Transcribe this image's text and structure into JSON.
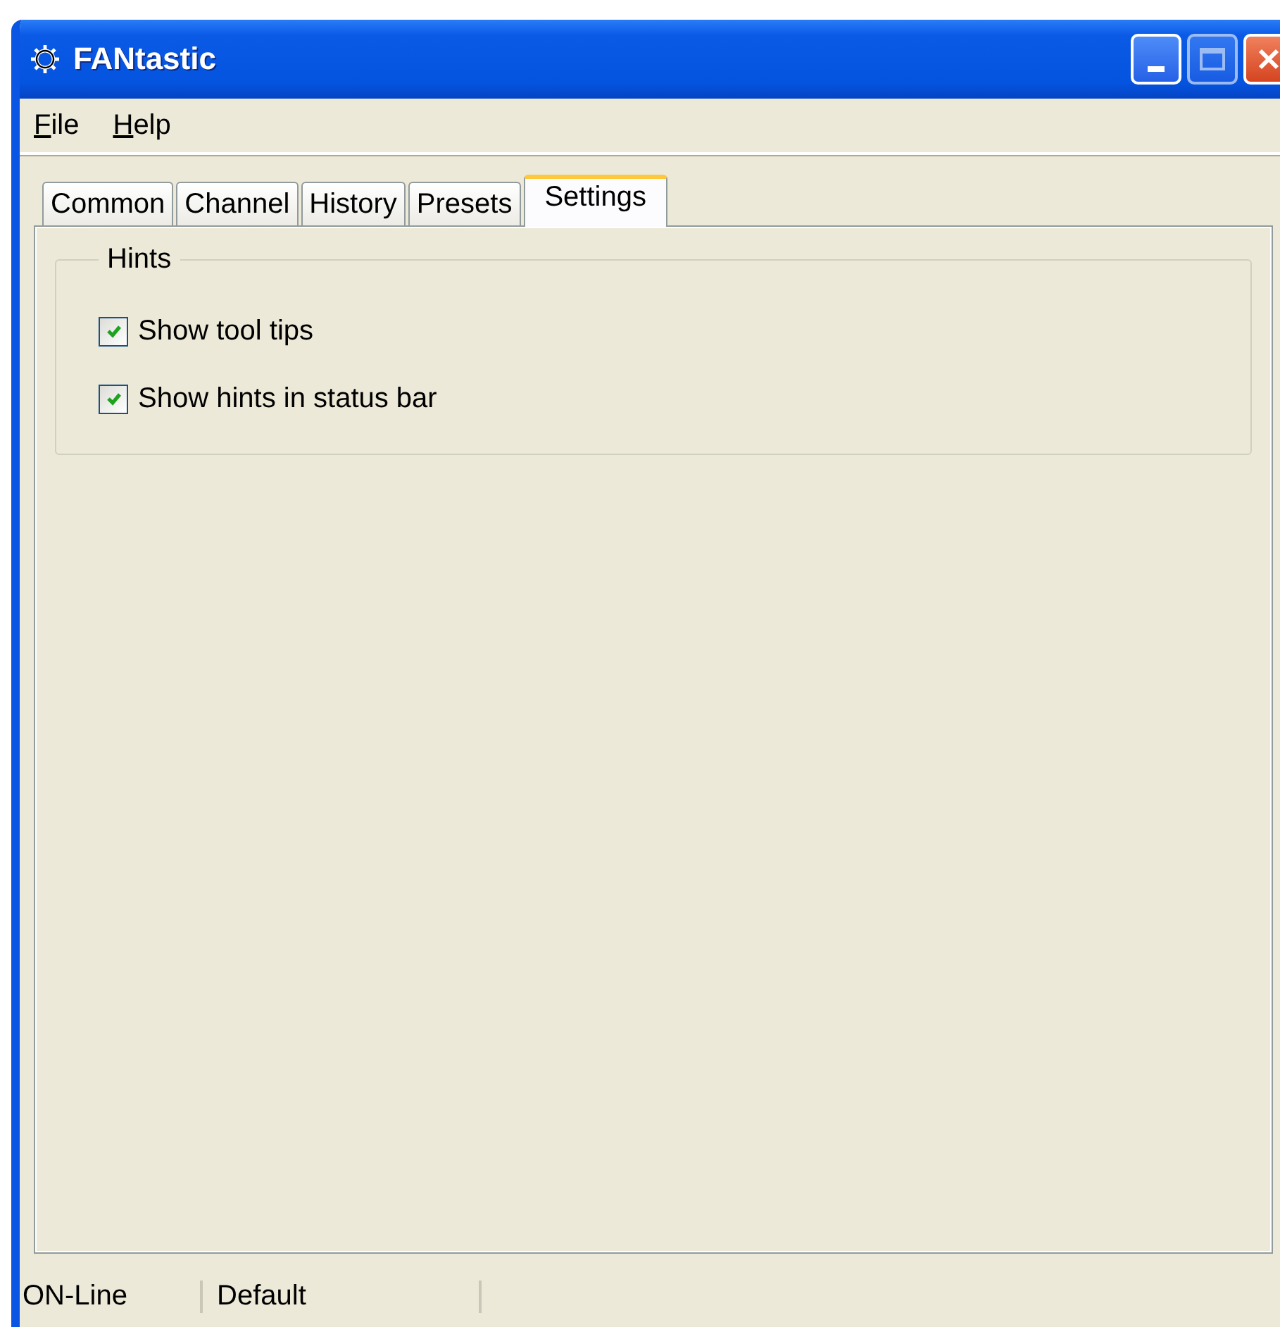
{
  "window": {
    "title": "FANtastic"
  },
  "menu": [
    "File",
    "Help"
  ],
  "tabs": [
    {
      "label": "Common",
      "selected": false
    },
    {
      "label": "Channel",
      "selected": false
    },
    {
      "label": "History",
      "selected": false
    },
    {
      "label": "Presets",
      "selected": false
    },
    {
      "label": "Settings",
      "selected": true
    }
  ],
  "group": {
    "title": "Hints",
    "options": [
      {
        "label": "Show tool tips",
        "checked": true
      },
      {
        "label": "Show hints in status bar",
        "checked": true
      }
    ]
  },
  "status_bar": [
    "ON-Line",
    "Default"
  ]
}
